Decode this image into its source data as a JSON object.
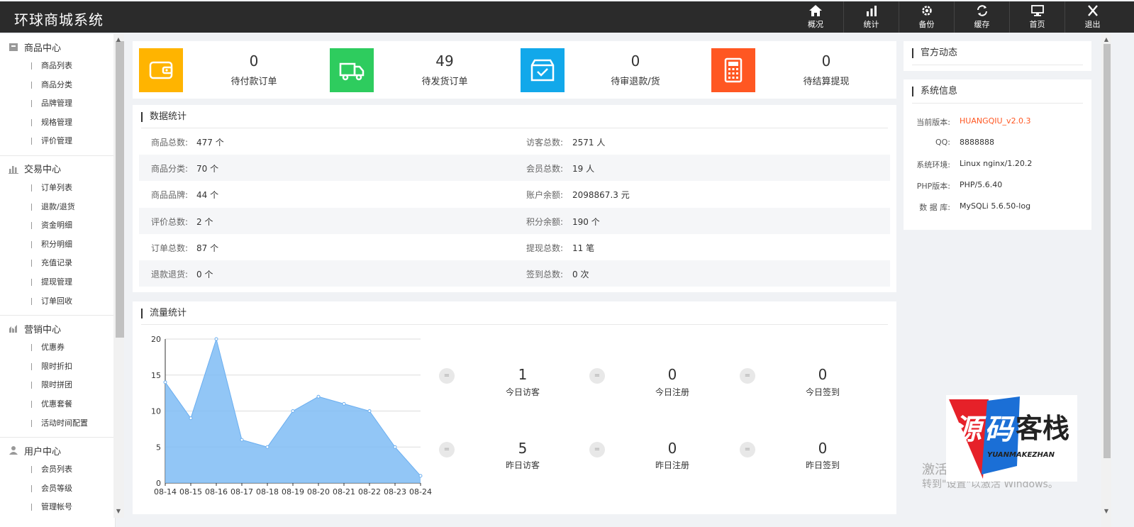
{
  "app": {
    "title": "环球商城系统"
  },
  "top_nav": [
    {
      "label": "概况",
      "icon": "home-icon"
    },
    {
      "label": "统计",
      "icon": "bar-chart-icon"
    },
    {
      "label": "备份",
      "icon": "gear-icon"
    },
    {
      "label": "缓存",
      "icon": "refresh-icon"
    },
    {
      "label": "首页",
      "icon": "monitor-icon"
    },
    {
      "label": "退出",
      "icon": "close-icon"
    }
  ],
  "sidebar": {
    "groups": [
      {
        "title": "商品中心",
        "icon": "box-icon",
        "items": [
          "商品列表",
          "商品分类",
          "品牌管理",
          "规格管理",
          "评价管理"
        ]
      },
      {
        "title": "交易中心",
        "icon": "bar-chart-icon",
        "items": [
          "订单列表",
          "退款/退货",
          "资金明细",
          "积分明细",
          "充值记录",
          "提现管理",
          "订单回收"
        ]
      },
      {
        "title": "营销中心",
        "icon": "chart-icon",
        "items": [
          "优惠券",
          "限时折扣",
          "限时拼团",
          "优惠套餐",
          "活动时间配置"
        ]
      },
      {
        "title": "用户中心",
        "icon": "user-icon",
        "items": [
          "会员列表",
          "会员等级",
          "管理帐号"
        ]
      }
    ]
  },
  "summary_cards": [
    {
      "value": "0",
      "label": "待付款订单",
      "color": "#ffb400",
      "icon": "wallet-icon"
    },
    {
      "value": "49",
      "label": "待发货订单",
      "color": "#2ecc5e",
      "icon": "truck-icon"
    },
    {
      "value": "0",
      "label": "待审退款/货",
      "color": "#12a8ea",
      "icon": "box-check-icon"
    },
    {
      "value": "0",
      "label": "待结算提现",
      "color": "#ff5722",
      "icon": "calculator-icon"
    }
  ],
  "data_stats": {
    "title": "数据统计",
    "rows": [
      {
        "l_label": "商品总数:",
        "l_value": "477 个",
        "r_label": "访客总数:",
        "r_value": "2571 人"
      },
      {
        "l_label": "商品分类:",
        "l_value": "70 个",
        "r_label": "会员总数:",
        "r_value": "19 人"
      },
      {
        "l_label": "商品品牌:",
        "l_value": "44 个",
        "r_label": "账户余额:",
        "r_value": "2098867.3 元"
      },
      {
        "l_label": "评价总数:",
        "l_value": "2 个",
        "r_label": "积分余额:",
        "r_value": "190 个"
      },
      {
        "l_label": "订单总数:",
        "l_value": "87 个",
        "r_label": "提现总数:",
        "r_value": "11 笔"
      },
      {
        "l_label": "退款退货:",
        "l_value": "0 个",
        "r_label": "签到总数:",
        "r_value": "0 次"
      }
    ]
  },
  "traffic": {
    "title": "流量统计",
    "eq_symbol": "=",
    "today": [
      {
        "value": "1",
        "label": "今日访客"
      },
      {
        "value": "0",
        "label": "今日注册"
      },
      {
        "value": "0",
        "label": "今日签到"
      }
    ],
    "yesterday": [
      {
        "value": "5",
        "label": "昨日访客"
      },
      {
        "value": "0",
        "label": "昨日注册"
      },
      {
        "value": "0",
        "label": "昨日签到"
      }
    ]
  },
  "chart_data": {
    "type": "area",
    "x": [
      "08-14",
      "08-15",
      "08-16",
      "08-17",
      "08-18",
      "08-19",
      "08-20",
      "08-21",
      "08-22",
      "08-23",
      "08-24"
    ],
    "series": [
      {
        "values": [
          14,
          9,
          20,
          6,
          5,
          10,
          12,
          11,
          10,
          5,
          1
        ]
      }
    ],
    "ylim": [
      0,
      20
    ],
    "yticks": [
      0,
      5,
      10,
      15,
      20
    ],
    "grid": true,
    "color": "#7fbcf5"
  },
  "right": {
    "official_title": "官方动态",
    "sysinfo_title": "系统信息",
    "sysinfo": [
      {
        "label": "当前版本:",
        "value": "HUANGQIU_v2.0.3",
        "highlight": true
      },
      {
        "label": "QQ:",
        "value": "8888888"
      },
      {
        "label": "系统环境:",
        "value": "Linux nginx/1.20.2"
      },
      {
        "label": "PHP版本:",
        "value": "PHP/5.6.40"
      },
      {
        "label": "数 据 库:",
        "value": "MySQLi 5.6.50-log"
      }
    ],
    "activate_line1": "激活",
    "activate_line2": "转到\"设置\"以激活 Windows。",
    "watermark_text": "源码客栈",
    "watermark_sub": "YUANMAKEZHAN"
  }
}
